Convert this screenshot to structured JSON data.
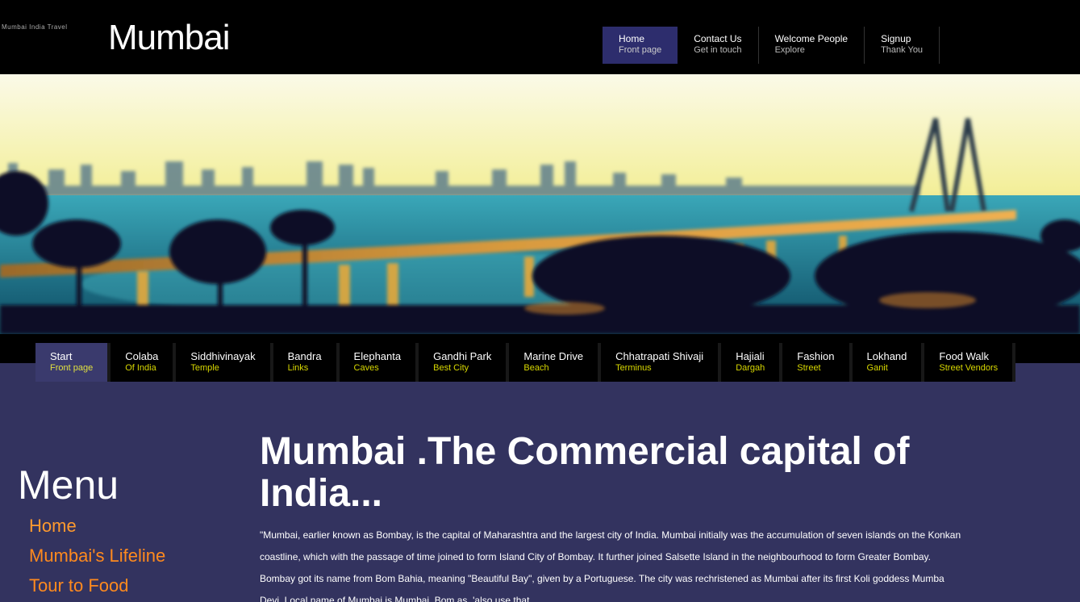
{
  "header": {
    "tagline": "Mumbai India Travel",
    "title": "Mumbai",
    "nav": [
      {
        "label": "Home",
        "sub": "Front page",
        "active": true
      },
      {
        "label": "Contact Us",
        "sub": "Get in touch"
      },
      {
        "label": "Welcome People",
        "sub": "Explore"
      },
      {
        "label": "Signup",
        "sub": "Thank You"
      }
    ]
  },
  "categories": [
    {
      "label": "Start",
      "sub": "Front page",
      "active": true
    },
    {
      "label": "Colaba",
      "sub": "Of India"
    },
    {
      "label": "Siddhivinayak",
      "sub": "Temple"
    },
    {
      "label": "Bandra",
      "sub": "Links"
    },
    {
      "label": "Elephanta",
      "sub": "Caves"
    },
    {
      "label": "Gandhi Park",
      "sub": "Best City"
    },
    {
      "label": "Marine Drive",
      "sub": "Beach"
    },
    {
      "label": "Chhatrapati Shivaji",
      "sub": "Terminus"
    },
    {
      "label": "Hajiali",
      "sub": "Dargah"
    },
    {
      "label": "Fashion",
      "sub": "Street"
    },
    {
      "label": "Lokhand",
      "sub": "Ganit"
    },
    {
      "label": "Food Walk",
      "sub": "Street Vendors"
    }
  ],
  "sidebar": {
    "title": "Menu",
    "items": [
      "Home",
      "Mumbai's Lifeline",
      "Tour to Food"
    ]
  },
  "main": {
    "title": "Mumbai .The Commercial capital of India...",
    "body": "\"Mumbai, earlier known as Bombay, is the capital of Maharashtra and the largest city of India. Mumbai initially was the accumulation of seven islands on the Konkan coastline, which with the passage of time joined to form Island City of Bombay. It further joined Salsette Island in the neighbourhood to form Greater Bombay. Bombay got its name from Bom Bahia, meaning \"Beautiful Bay\", given by a Portuguese. The city was rechristened as Mumbai after its first Koli goddess Mumba Devi. Local name of Mumbai is Mumbai, Bom as, 'also use that"
  },
  "colors": {
    "page_bg": "#33335f",
    "accent_orange": "#ff8a1e",
    "accent_yellow": "#d8d800",
    "nav_active": "#2d2d6d"
  }
}
